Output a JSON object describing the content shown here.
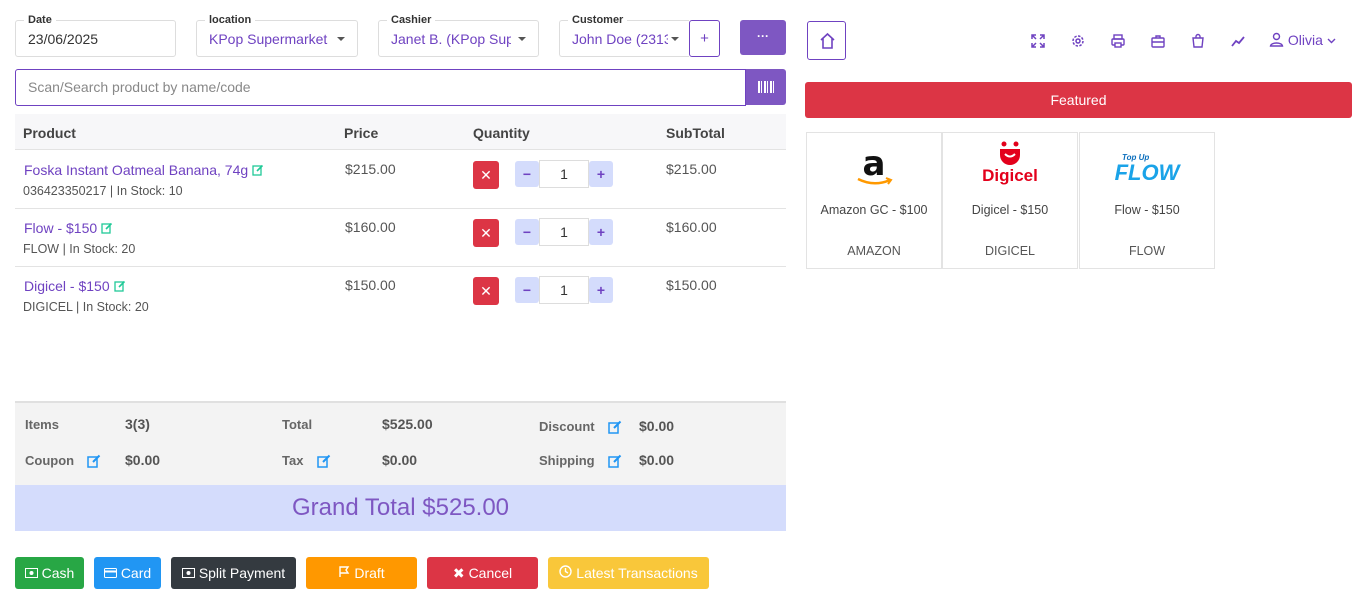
{
  "filters": {
    "date": {
      "label": "Date",
      "value": "23/06/2025"
    },
    "location": {
      "label": "location",
      "value": "KPop Supermarket"
    },
    "cashier": {
      "label": "Cashier",
      "value": "Janet B. (KPop Supe"
    },
    "customer": {
      "label": "Customer",
      "value": "John Doe (2313"
    },
    "add_customer_label": "+",
    "more_label": "···"
  },
  "search": {
    "placeholder": "Scan/Search product by name/code"
  },
  "table": {
    "headers": [
      "Product",
      "Price",
      "Quantity",
      "SubTotal"
    ],
    "rows": [
      {
        "name": "Foska Instant Oatmeal Banana, 74g",
        "meta": "036423350217 | In Stock: 10",
        "price": "$215.00",
        "qty": "1",
        "subtotal": "$215.00"
      },
      {
        "name": "Flow - $150",
        "meta": "FLOW | In Stock: 20",
        "price": "$160.00",
        "qty": "1",
        "subtotal": "$160.00"
      },
      {
        "name": "Digicel - $150",
        "meta": "DIGICEL | In Stock: 20",
        "price": "$150.00",
        "qty": "1",
        "subtotal": "$150.00"
      }
    ]
  },
  "totals": {
    "items_label": "Items",
    "items_value": "3(3)",
    "total_label": "Total",
    "total_value": "$525.00",
    "discount_label": "Discount",
    "discount_value": "$0.00",
    "coupon_label": "Coupon",
    "coupon_value": "$0.00",
    "tax_label": "Tax",
    "tax_value": "$0.00",
    "shipping_label": "Shipping",
    "shipping_value": "$0.00",
    "grand_total": "Grand Total $525.00"
  },
  "actions": {
    "cash": "Cash",
    "card": "Card",
    "split": "Split Payment",
    "draft": "Draft",
    "cancel": "Cancel",
    "latest": "Latest Transactions"
  },
  "header": {
    "user_name": "Olivia"
  },
  "featured": {
    "title": "Featured",
    "items": [
      {
        "name": "Amazon GC - $100",
        "brand": "AMAZON",
        "logo_text": "a"
      },
      {
        "name": "Digicel - $150",
        "brand": "DIGICEL",
        "logo_text": "Digicel"
      },
      {
        "name": "Flow - $150",
        "brand": "FLOW",
        "logo_text": "FLOW",
        "logo_subtext": "Top Up"
      }
    ]
  },
  "colors": {
    "accent": "#7e57c2",
    "danger": "#dc3545",
    "cash": "#28a745",
    "card": "#2196f3",
    "split": "#343a40",
    "draft": "#ff9800",
    "latest": "#f9c73a"
  }
}
